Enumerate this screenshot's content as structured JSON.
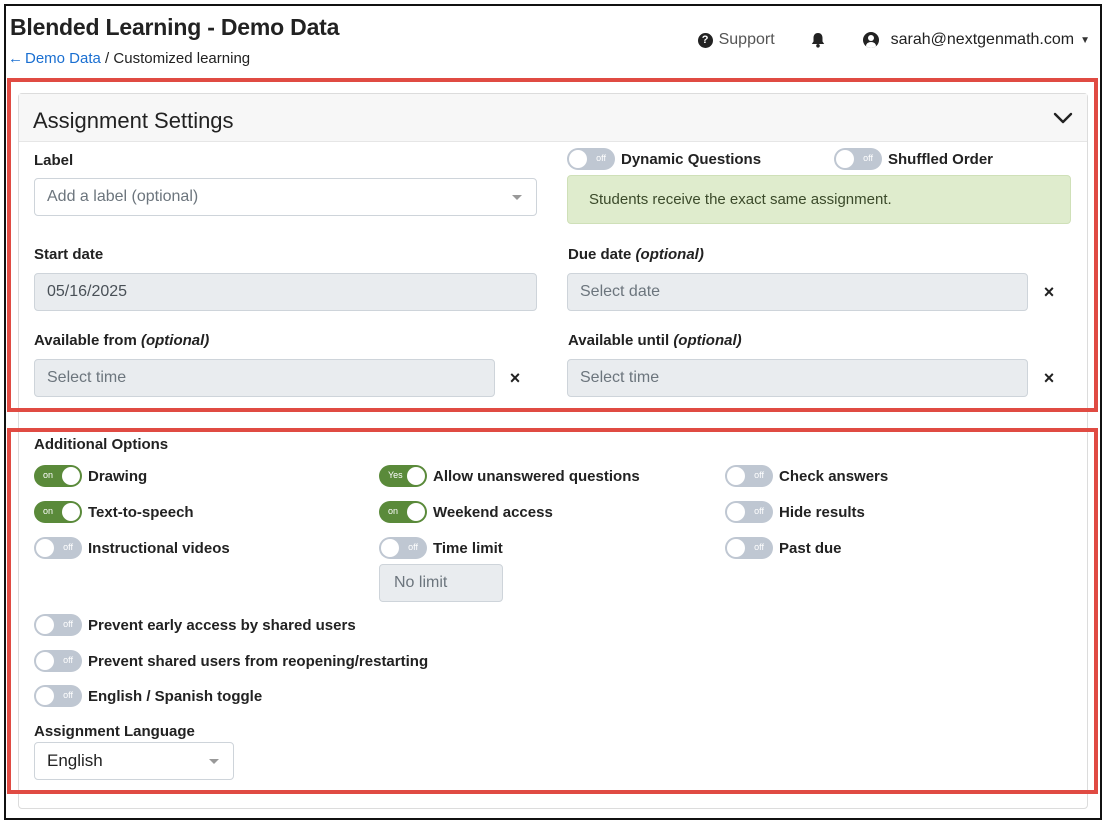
{
  "header": {
    "title": "Blended Learning - Demo Data",
    "breadcrumb_link": "Demo Data",
    "breadcrumb_separator": "/",
    "breadcrumb_current": "Customized learning",
    "support_label": "Support",
    "user_email": "sarah@nextgenmath.com"
  },
  "settings": {
    "title": "Assignment Settings",
    "label_heading": "Label",
    "label_placeholder": "Add a label (optional)",
    "dynamic_questions": {
      "label": "Dynamic Questions",
      "state": "off"
    },
    "shuffled_order": {
      "label": "Shuffled Order",
      "state": "off"
    },
    "info_message": "Students receive the exact same assignment.",
    "start_date_label": "Start date",
    "start_date_value": "05/16/2025",
    "due_date_label": "Due date",
    "due_date_note": "(optional)",
    "due_date_placeholder": "Select date",
    "available_from_label": "Available from",
    "available_from_note": "(optional)",
    "available_from_placeholder": "Select time",
    "available_until_label": "Available until",
    "available_until_note": "(optional)",
    "available_until_placeholder": "Select time",
    "clear_symbol": "×"
  },
  "additional": {
    "heading": "Additional Options",
    "drawing": {
      "label": "Drawing",
      "state": "on"
    },
    "text_to_speech": {
      "label": "Text-to-speech",
      "state": "on"
    },
    "instructional_videos": {
      "label": "Instructional videos",
      "state": "off"
    },
    "allow_unanswered": {
      "label": "Allow unanswered questions",
      "state": "Yes"
    },
    "weekend_access": {
      "label": "Weekend access",
      "state": "on"
    },
    "time_limit": {
      "label": "Time limit",
      "state": "off"
    },
    "time_limit_value": "No limit",
    "check_answers": {
      "label": "Check answers",
      "state": "off"
    },
    "hide_results": {
      "label": "Hide results",
      "state": "off"
    },
    "past_due": {
      "label": "Past due",
      "state": "off"
    },
    "prevent_early": {
      "label": "Prevent early access by shared users",
      "state": "off"
    },
    "prevent_reopen": {
      "label": "Prevent shared users from reopening/restarting",
      "state": "off"
    },
    "english_spanish": {
      "label": "English / Spanish toggle",
      "state": "off"
    },
    "language_label": "Assignment Language",
    "language_value": "English"
  },
  "colors": {
    "highlight_border": "#e04b43",
    "toggle_on": "#5a8a3a",
    "toggle_off": "#bfc7d2",
    "link": "#1a6fd1",
    "info_bg": "#dfeccd"
  }
}
